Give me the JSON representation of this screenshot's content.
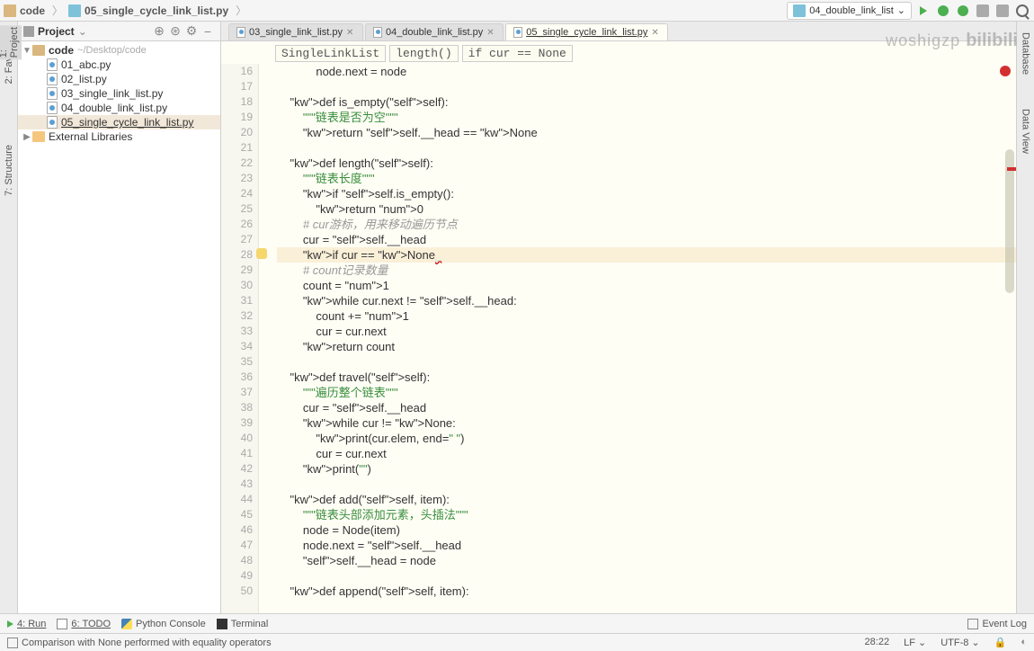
{
  "nav": {
    "root": "code",
    "file": "05_single_cycle_link_list.py",
    "run_config": "04_double_link_list"
  },
  "project": {
    "title": "Project",
    "root_name": "code",
    "root_path": "~/Desktop/code",
    "files": [
      "01_abc.py",
      "02_list.py",
      "03_single_link_list.py",
      "04_double_link_list.py",
      "05_single_cycle_link_list.py"
    ],
    "external": "External Libraries"
  },
  "tabs": [
    {
      "label": "03_single_link_list.py",
      "active": false
    },
    {
      "label": "04_double_link_list.py",
      "active": false
    },
    {
      "label": "05_single_cycle_link_list.py",
      "active": true
    }
  ],
  "breadcrumb": {
    "class": "SingleLinkList",
    "method": "length()",
    "stmt": "if cur == None"
  },
  "gutter": {
    "start": 16,
    "end": 50,
    "lightbulb_at": 28
  },
  "code_lines": [
    "            node.next = node",
    "",
    "    def is_empty(self):",
    "        \"\"\"链表是否为空\"\"\"",
    "        return self.__head == None",
    "",
    "    def length(self):",
    "        \"\"\"链表长度\"\"\"",
    "        if self.is_empty():",
    "            return 0",
    "        # cur游标，用来移动遍历节点",
    "        cur = self.__head",
    "        if cur == None",
    "        # count记录数量",
    "        count = 1",
    "        while cur.next != self.__head:",
    "            count += 1",
    "            cur = cur.next",
    "        return count",
    "",
    "    def travel(self):",
    "        \"\"\"遍历整个链表\"\"\"",
    "        cur = self.__head",
    "        while cur != None:",
    "            print(cur.elem, end=\" \")",
    "            cur = cur.next",
    "        print(\"\")",
    "",
    "    def add(self, item):",
    "        \"\"\"链表头部添加元素，头插法\"\"\"",
    "        node = Node(item)",
    "        node.next = self.__head",
    "        self.__head = node",
    "",
    "    def append(self, item):"
  ],
  "highlight_line": 28,
  "bottom_tools": {
    "run": "4: Run",
    "todo": "6: TODO",
    "python_console": "Python Console",
    "terminal": "Terminal",
    "event_log": "Event Log"
  },
  "status": {
    "message": "Comparison with None performed with equality operators",
    "position": "28:22",
    "line_sep": "LF ⌄",
    "encoding": "UTF-8 ⌄"
  },
  "watermark": {
    "name": "woshigzp",
    "logo": "bilibili"
  }
}
